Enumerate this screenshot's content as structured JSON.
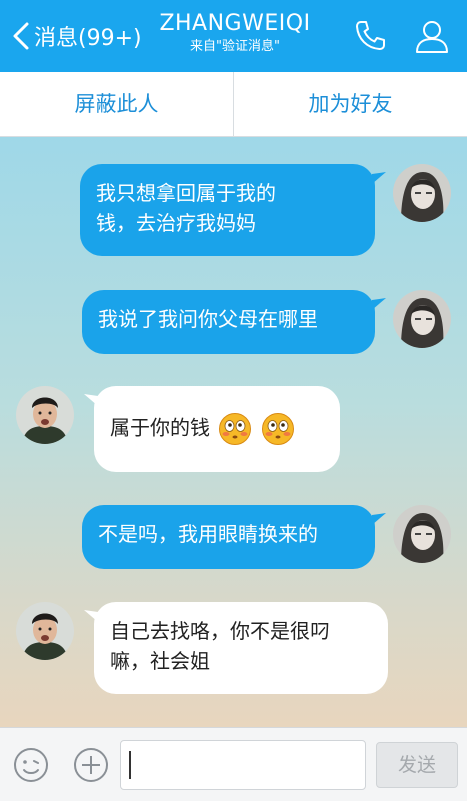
{
  "header": {
    "back_label": "消息(99+)",
    "title": "ZHANGWEIQI",
    "subtitle": "来自\"验证消息\"",
    "icons": {
      "back": "chevron-left-icon",
      "phone": "phone-icon",
      "profile": "person-icon"
    },
    "background": "#1aa6ee"
  },
  "actions": {
    "block": "屏蔽此人",
    "add_friend": "加为好友"
  },
  "messages": [
    {
      "sender": "me",
      "text_line1": "我只想拿回属于我的",
      "text_line2": "钱，去治疗我妈妈"
    },
    {
      "sender": "me",
      "text": "我说了我问你父母在哪里"
    },
    {
      "sender": "other",
      "text": "属于你的钱",
      "emojis": [
        "flushed-face-emoji",
        "flushed-face-emoji"
      ]
    },
    {
      "sender": "me",
      "text": "不是吗，我用眼睛换来的"
    },
    {
      "sender": "other",
      "text_line1": "自己去找咯，你不是很叼",
      "text_line2": "嘛，社会姐"
    }
  ],
  "input": {
    "send_label": "发送",
    "icons": {
      "emoji": "smiley-icon",
      "more": "plus-circle-icon"
    }
  },
  "colors": {
    "outgoing_bubble": "#1aa3ea",
    "incoming_bubble": "#ffffff",
    "accent_text": "#1d8fd8"
  }
}
